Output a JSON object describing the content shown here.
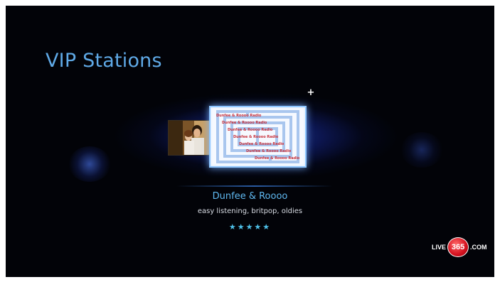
{
  "screen": {
    "title": "VIP Stations"
  },
  "featured_station": {
    "name": "Dunfee & Roooo",
    "genres": "easy listening, britpop, oldies",
    "rating_stars": 5,
    "rating_display": "★★★★★",
    "card_lines": [
      "Dunfee & Roooo Radio",
      "Dunfee & Roooo Radio",
      "Dunfee & Roooo Radio",
      "Dunfee & Roooo Radio",
      "Dunfee & Roooo Radio",
      "Dunfee & Roooo Radio",
      "Dunfee & Roooo Radio"
    ]
  },
  "controls": {
    "add_icon": "plus-icon",
    "add_glyph": "+"
  },
  "logo": {
    "prefix": "LIVE",
    "badge": "365",
    "suffix": ".COM"
  },
  "colors": {
    "title": "#5fa9e6",
    "station_name": "#5fb8f0",
    "stars": "#4ec0e8",
    "card_text": "#c8313b",
    "card_maze": "#a9c6ee",
    "logo_badge": "#d4101e"
  }
}
